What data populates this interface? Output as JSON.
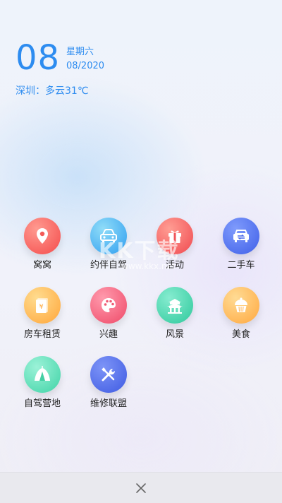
{
  "date": {
    "day": "08",
    "weekday": "星期六",
    "month_year": "08/2020"
  },
  "weather": {
    "text": "深圳：多云31℃"
  },
  "menu": {
    "items": [
      {
        "label": "窝窝",
        "icon": "location-pin-icon",
        "color_start": "#ff8a80",
        "color_end": "#f44b4b"
      },
      {
        "label": "约伴自驾",
        "icon": "car-icon",
        "color_start": "#7fd3f5",
        "color_end": "#2f9ef0"
      },
      {
        "label": "活动",
        "icon": "gift-icon",
        "color_start": "#ff8f84",
        "color_end": "#f0494f"
      },
      {
        "label": "二手车",
        "icon": "car-exchange-icon",
        "color_start": "#6f8dfb",
        "color_end": "#3f5fe8"
      },
      {
        "label": "房车租赁",
        "icon": "rental-document-icon",
        "color_start": "#ffd27a",
        "color_end": "#ffa63a"
      },
      {
        "label": "兴趣",
        "icon": "palette-icon",
        "color_start": "#ff8aa0",
        "color_end": "#ef4a68"
      },
      {
        "label": "风景",
        "icon": "pavilion-icon",
        "color_start": "#6fe6c2",
        "color_end": "#2fc99c"
      },
      {
        "label": "美食",
        "icon": "cupcake-icon",
        "color_start": "#ffd380",
        "color_end": "#ffa83f"
      },
      {
        "label": "自驾营地",
        "icon": "tent-icon",
        "color_start": "#8cefd0",
        "color_end": "#3fd3a6"
      },
      {
        "label": "维修联盟",
        "icon": "wrench-screwdriver-icon",
        "color_start": "#6d87f5",
        "color_end": "#3f5be2"
      }
    ]
  },
  "watermark": {
    "big": "KK下载",
    "small": "www.kkx.net"
  },
  "bottom": {
    "close_icon": "close-icon"
  }
}
